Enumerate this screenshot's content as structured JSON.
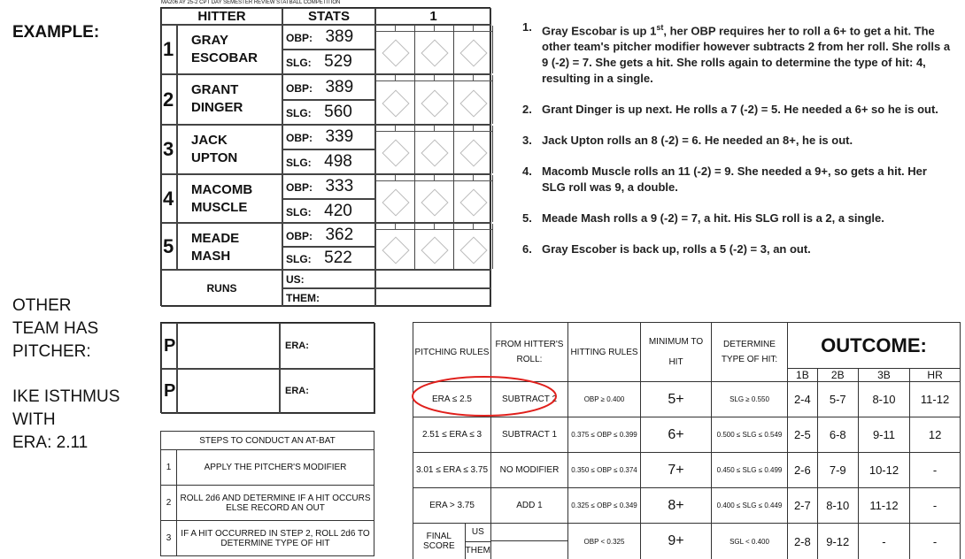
{
  "left": {
    "example_label": "EXAMPLE:",
    "other_team_lines": [
      "OTHER",
      "TEAM HAS",
      "PITCHER:"
    ],
    "pitcher_lines": [
      "IKE ISTHMUS",
      "WITH",
      "ERA: 2.11"
    ]
  },
  "scorecard": {
    "caption": "MA206 AY 25-2 CPT DAY SEMESTER REVIEW STATBALL COMPETITION",
    "hitter_header": "HITTER",
    "stats_header": "STATS",
    "inning_header": "1",
    "obp_label": "OBP:",
    "slg_label": "SLG:",
    "hitters": [
      {
        "num": "1",
        "first": "GRAY",
        "last": "ESCOBAR",
        "obp": "389",
        "slg": "529"
      },
      {
        "num": "2",
        "first": "GRANT",
        "last": "DINGER",
        "obp": "389",
        "slg": "560"
      },
      {
        "num": "3",
        "first": "JACK",
        "last": "UPTON",
        "obp": "339",
        "slg": "498"
      },
      {
        "num": "4",
        "first": "MACOMB",
        "last": "MUSCLE",
        "obp": "333",
        "slg": "420"
      },
      {
        "num": "5",
        "first": "MEADE",
        "last": "MASH",
        "obp": "362",
        "slg": "522"
      }
    ],
    "runs_label": "RUNS",
    "us_label": "US:",
    "them_label": "THEM:"
  },
  "pitchers": {
    "p_label": "P",
    "era_label": "ERA:"
  },
  "steps": {
    "title": "STEPS TO CONDUCT AN AT-BAT",
    "items": [
      {
        "num": "1",
        "text": "APPLY THE PITCHER'S MODIFIER"
      },
      {
        "num": "2",
        "text": "ROLL 2d6 AND DETERMINE IF A HIT OCCURS ELSE RECORD AN OUT"
      },
      {
        "num": "3",
        "text": "IF A HIT OCCURRED IN STEP 2, ROLL 2d6 TO DETERMINE TYPE OF HIT"
      }
    ]
  },
  "rules": {
    "h_pitching": "PITCHING RULES",
    "h_from": "FROM HITTER'S ROLL:",
    "h_hitting": "HITTING RULES",
    "h_min": "MINIMUM TO HIT",
    "h_determine": "DETERMINE TYPE OF HIT:",
    "h_outcome": "OUTCOME:",
    "outcome_cols": [
      "1B",
      "2B",
      "3B",
      "HR"
    ],
    "rows": [
      {
        "era": "ERA ≤ 2.5",
        "mod": "SUBTRACT 2",
        "obp": "OBP ≥ 0.400",
        "min": "5+",
        "slg": "SLG ≥ 0.550",
        "o1": "2-4",
        "o2": "5-7",
        "o3": "8-10",
        "o4": "11-12"
      },
      {
        "era": "2.51 ≤ ERA ≤ 3",
        "mod": "SUBTRACT 1",
        "obp": "0.375 ≤ OBP ≤ 0.399",
        "min": "6+",
        "slg": "0.500 ≤ SLG ≤ 0.549",
        "o1": "2-5",
        "o2": "6-8",
        "o3": "9-11",
        "o4": "12"
      },
      {
        "era": "3.01 ≤ ERA ≤ 3.75",
        "mod": "NO MODIFIER",
        "obp": "0.350 ≤ OBP ≤ 0.374",
        "min": "7+",
        "slg": "0.450 ≤ SLG ≤ 0.499",
        "o1": "2-6",
        "o2": "7-9",
        "o3": "10-12",
        "o4": "-"
      },
      {
        "era": "ERA > 3.75",
        "mod": "ADD 1",
        "obp": "0.325 ≤ OBP ≤ 0.349",
        "min": "8+",
        "slg": "0.400 ≤ SLG ≤ 0.449",
        "o1": "2-7",
        "o2": "8-10",
        "o3": "11-12",
        "o4": "-"
      },
      {
        "era": "",
        "mod": "",
        "obp": "OBP < 0.325",
        "min": "9+",
        "slg": "SGL < 0.400",
        "o1": "2-8",
        "o2": "9-12",
        "o3": "-",
        "o4": "-"
      }
    ],
    "final_score": "FINAL SCORE",
    "us": "US",
    "them": "THEM"
  },
  "instructions": [
    {
      "n": "1.",
      "pre": "Gray Escobar is up 1",
      "sup": "st",
      "post": ",  her OBP requires her to roll a 6+ to get a hit. The other team's pitcher modifier however subtracts 2 from her roll. She rolls a 9 (-2) = 7. She gets a hit. She rolls again to determine the type of hit: 4, resulting in a single."
    },
    {
      "n": "2.",
      "pre": "Grant Dinger is up next. He rolls a 7 (-2) = 5. He needed a 6+ so he is out.",
      "sup": "",
      "post": ""
    },
    {
      "n": "3.",
      "pre": "Jack Upton rolls an 8 (-2) = 6. He needed an 8+, he is out.",
      "sup": "",
      "post": ""
    },
    {
      "n": "4.",
      "pre": "Macomb Muscle rolls an 11 (-2) = 9. She needed a 9+, so gets a hit. Her SLG roll was 9, a double.",
      "sup": "",
      "post": ""
    },
    {
      "n": "5.",
      "pre": "Meade Mash rolls a 9 (-2) = 7, a hit. His SLG roll is a 2, a single.",
      "sup": "",
      "post": ""
    },
    {
      "n": "6.",
      "pre": "Gray Escober is back up, rolls a 5 (-2) = 3, an out.",
      "sup": "",
      "post": ""
    }
  ],
  "colors": {
    "highlight_circle": "#e0201c"
  }
}
